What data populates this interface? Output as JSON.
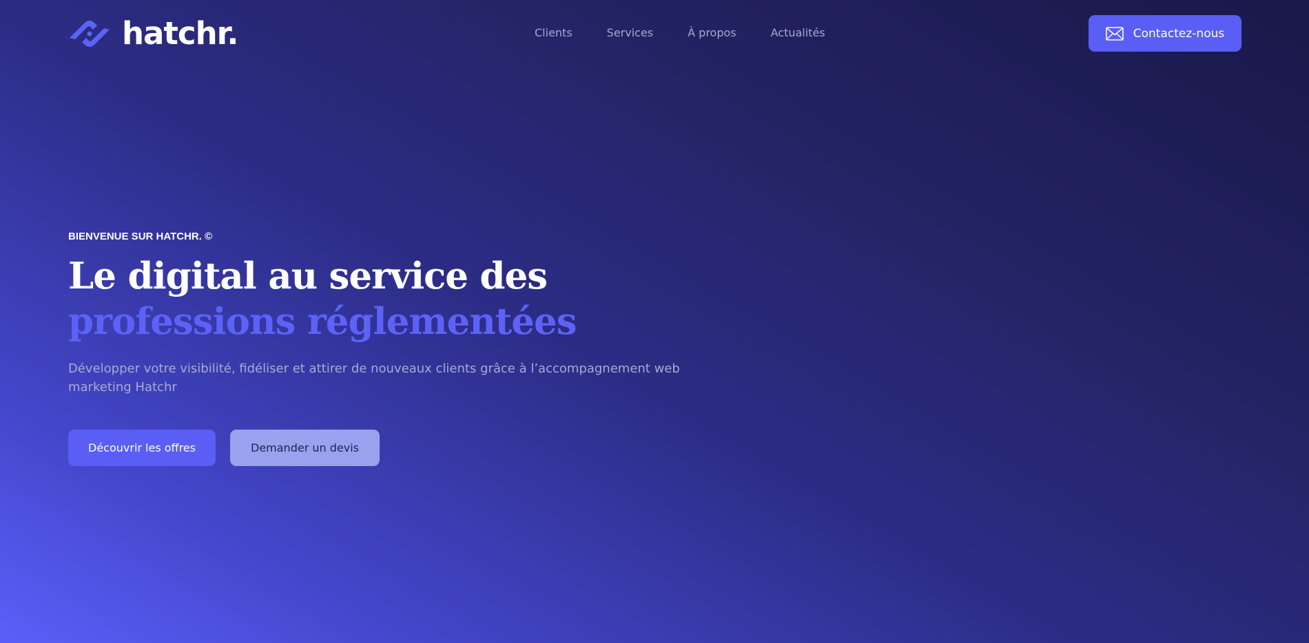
{
  "brand": {
    "name": "hatchr.",
    "logo_icon": "hatchr-logo-mark",
    "accent_color": "#5a5ef5"
  },
  "nav": {
    "items": [
      {
        "label": "Clients"
      },
      {
        "label": "Services"
      },
      {
        "label": "À propos"
      },
      {
        "label": "Actualités"
      }
    ]
  },
  "header": {
    "contact_label": "Contactez-nous",
    "contact_icon": "mail-icon"
  },
  "hero": {
    "eyebrow": "BIENVENUE SUR HATCHR. ©",
    "title_line1": "Le digital au service des",
    "title_line2": "professions réglementées",
    "lead": "Développer votre visibilité, fidéliser et attirer de nouveaux clients grâce à l’accompagnement web marketing Hatchr",
    "primary_cta": "Découvrir les offres",
    "secondary_cta": "Demander un devis"
  }
}
